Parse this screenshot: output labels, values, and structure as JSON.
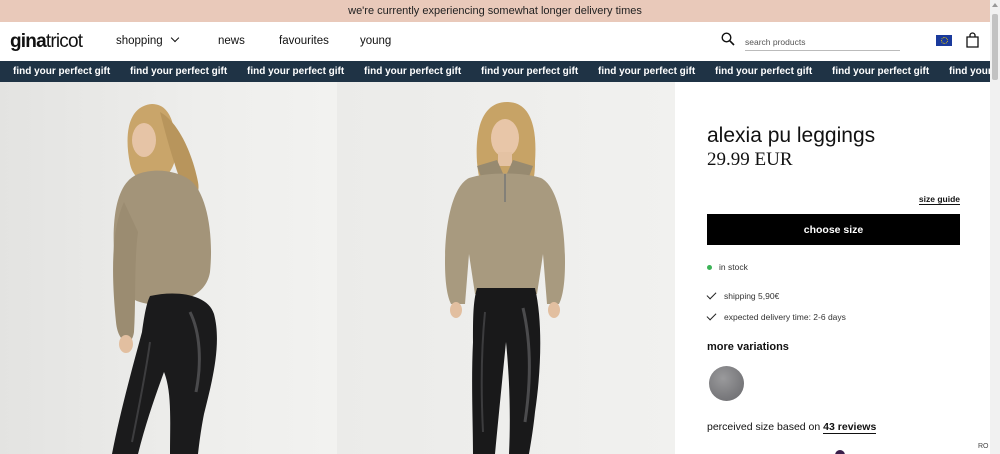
{
  "announcement": "we're currently experiencing somewhat longer delivery times",
  "header": {
    "logo_bold": "gina",
    "logo_regular": "tricot",
    "nav": [
      {
        "label": "shopping",
        "has_dropdown": true
      },
      {
        "label": "news"
      },
      {
        "label": "favourites"
      },
      {
        "label": "young"
      }
    ],
    "search_placeholder": "search products",
    "icons": {
      "search": "search-icon",
      "flag": "eu-flag-icon",
      "cart": "shopping-bag-icon"
    }
  },
  "marquee": {
    "text": "find your perfect gift",
    "repeat": 9,
    "background": "#1f3345"
  },
  "gallery": {
    "images": [
      {
        "name": "model-side-view-photo"
      },
      {
        "name": "model-front-view-photo"
      }
    ]
  },
  "product": {
    "title": "alexia pu leggings",
    "price": "29.99 EUR",
    "size_guide": "size guide",
    "choose_size": "choose size",
    "stock": "in stock",
    "stock_color": "#3cb357",
    "benefits": [
      "shipping 5,90€",
      "expected delivery time: 2-6 days"
    ],
    "more_variations": "more variations",
    "variation_colors": [
      "#808083"
    ],
    "perceived_prefix": "perceived size based on",
    "reviews_link": "43 reviews"
  },
  "lang_badge": "RO"
}
